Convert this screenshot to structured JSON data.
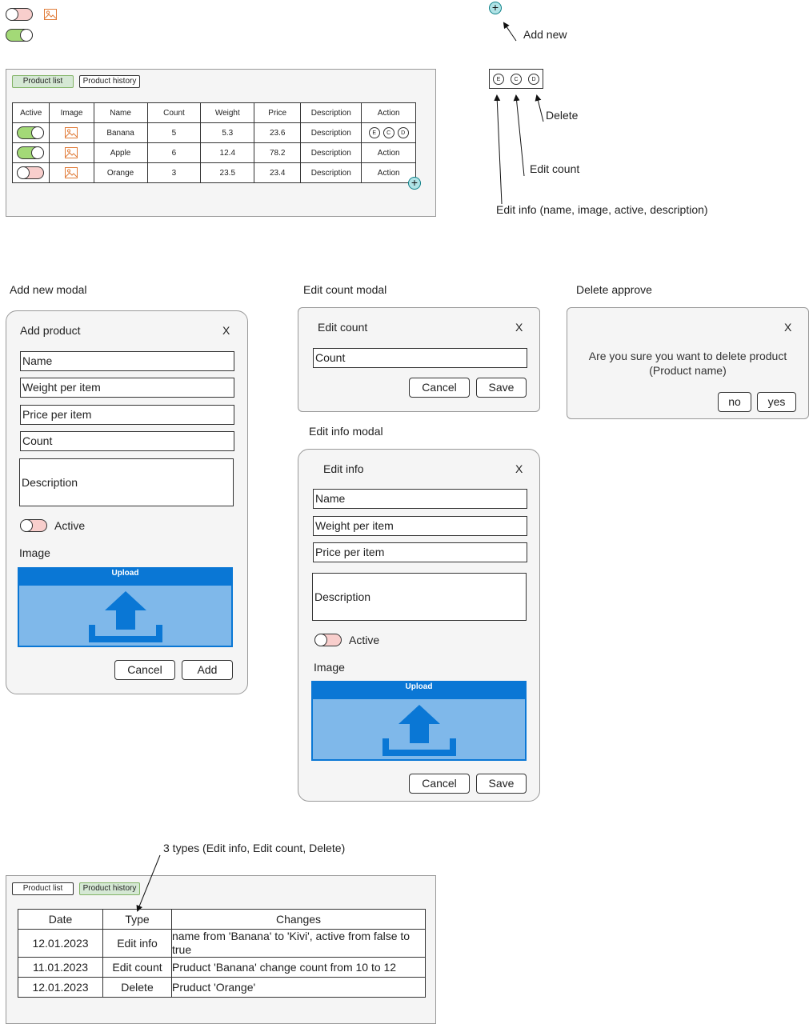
{
  "legend": {
    "toggle_off": "toggle-off",
    "toggle_on": "toggle-on",
    "image": "image-icon"
  },
  "tabs": {
    "product_list": "Product list",
    "product_history": "Product history"
  },
  "product_table": {
    "headers": [
      "Active",
      "Image",
      "Name",
      "Count",
      "Weight",
      "Price",
      "Description",
      "Action"
    ],
    "rows": [
      {
        "active": true,
        "name": "Banana",
        "count": "5",
        "weight": "5.3",
        "price": "23.6",
        "description": "Description",
        "action": ""
      },
      {
        "active": true,
        "name": "Apple",
        "count": "6",
        "weight": "12.4",
        "price": "78.2",
        "description": "Description",
        "action": "Action"
      },
      {
        "active": false,
        "name": "Orange",
        "count": "3",
        "weight": "23.5",
        "price": "23.4",
        "description": "Description",
        "action": "Action"
      }
    ],
    "action_letters": {
      "edit": "E",
      "count": "C",
      "delete": "D"
    }
  },
  "annotations": {
    "add_new": "Add new",
    "delete": "Delete",
    "edit_count": "Edit count",
    "edit_info": "Edit info (name, image, active, description)",
    "history_types": "3 types (Edit info, Edit count, Delete)"
  },
  "section_labels": {
    "add_new_modal": "Add new modal",
    "edit_count_modal": "Edit count modal",
    "delete_approve": "Delete approve",
    "edit_info_modal": "Edit info modal"
  },
  "add_modal": {
    "title": "Add product",
    "close": "X",
    "name": "Name",
    "weight": "Weight per item",
    "price": "Price per item",
    "count": "Count",
    "description": "Description",
    "active": "Active",
    "image": "Image",
    "upload": "Upload",
    "cancel": "Cancel",
    "add": "Add"
  },
  "edit_count_modal": {
    "title": "Edit count",
    "close": "X",
    "count": "Count",
    "cancel": "Cancel",
    "save": "Save"
  },
  "delete_modal": {
    "close": "X",
    "message1": "Are you sure you want to delete product",
    "message2": "(Product name)",
    "no": "no",
    "yes": "yes"
  },
  "edit_info_modal": {
    "title": "Edit info",
    "close": "X",
    "name": "Name",
    "weight": "Weight per item",
    "price": "Price per item",
    "description": "Description",
    "active": "Active",
    "image": "Image",
    "upload": "Upload",
    "cancel": "Cancel",
    "save": "Save"
  },
  "history_table": {
    "headers": [
      "Date",
      "Type",
      "Changes"
    ],
    "rows": [
      {
        "date": "12.01.2023",
        "type": "Edit info",
        "changes": "name from 'Banana' to 'Kivi', active from false to true"
      },
      {
        "date": "11.01.2023",
        "type": "Edit count",
        "changes": "Pruduct 'Banana' change count from 10 to 12"
      },
      {
        "date": "12.01.2023",
        "type": "Delete",
        "changes": "Pruduct 'Orange'"
      }
    ]
  },
  "colors": {
    "toggle_off": "#f8cecc",
    "toggle_on": "#a3d977",
    "tab_active": "#d5e8d4",
    "plus": "#b0e3e6",
    "upload_bg": "#7fb8ea",
    "upload_bar": "#0a77d5",
    "image_icon": "#e07b39"
  }
}
